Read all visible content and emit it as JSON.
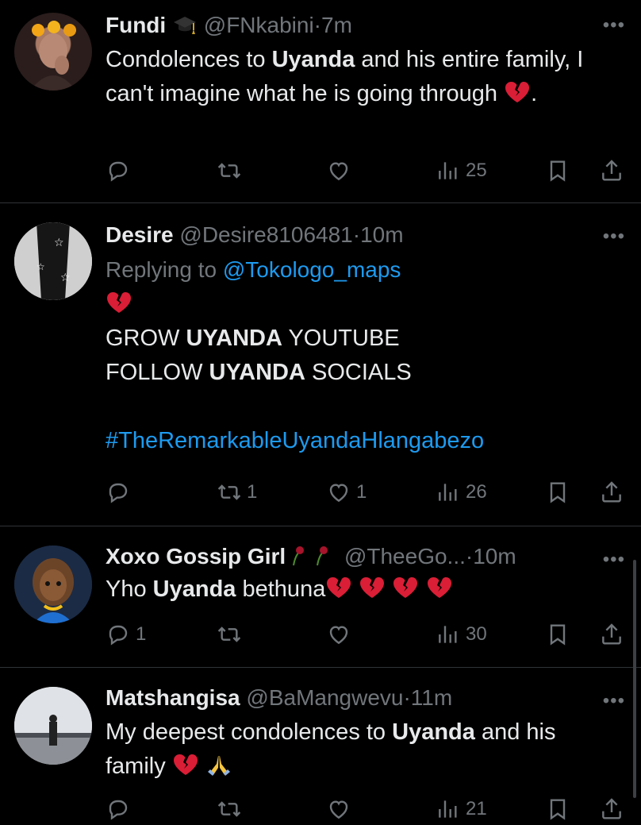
{
  "tweets": [
    {
      "name": "Fundi",
      "name_emoji": "graduation-cap",
      "handle": "@FNkabini",
      "time": "7m",
      "replying_to": "",
      "body_parts": [
        "Condolences to ",
        "Uyanda",
        " and his entire family, I can't imagine what he is going through",
        "."
      ],
      "reply_count": "",
      "retweet_count": "",
      "like_count": "",
      "views": "25"
    },
    {
      "name": "Desire",
      "handle": "@Desire8106481",
      "time": "10m",
      "replying_prefix": "Replying to ",
      "replying_to": "@Tokologo_maps",
      "line1_a": "GROW ",
      "line1_b": "UYANDA",
      "line1_c": " YOUTUBE",
      "line2_a": "FOLLOW ",
      "line2_b": "UYANDA",
      "line2_c": " SOCIALS",
      "hashtag": "#TheRemarkableUyandaHlangabezo",
      "reply_count": "",
      "retweet_count": "1",
      "like_count": "1",
      "views": "26"
    },
    {
      "name": "Xoxo Gossip Girl",
      "name_emoji": "wilted-rose",
      "handle": "@TheeGo...",
      "time": "10m",
      "body_a": "Yho ",
      "body_b": "Uyanda",
      "body_c": " bethuna",
      "reply_count": "1",
      "retweet_count": "",
      "like_count": "",
      "views": "30"
    },
    {
      "name": "Matshangisa",
      "handle": "@BaMangwevu",
      "time": "11m",
      "body_a": "My deepest condolences to ",
      "body_b": "Uyanda",
      "body_c": " and his family ",
      "views": "21"
    }
  ],
  "colors": {
    "background": "#000000",
    "text": "#e7e9ea",
    "muted": "#71767b",
    "link": "#1d9bf0",
    "divider": "#2f3336",
    "broken_heart": "#d91e36"
  }
}
